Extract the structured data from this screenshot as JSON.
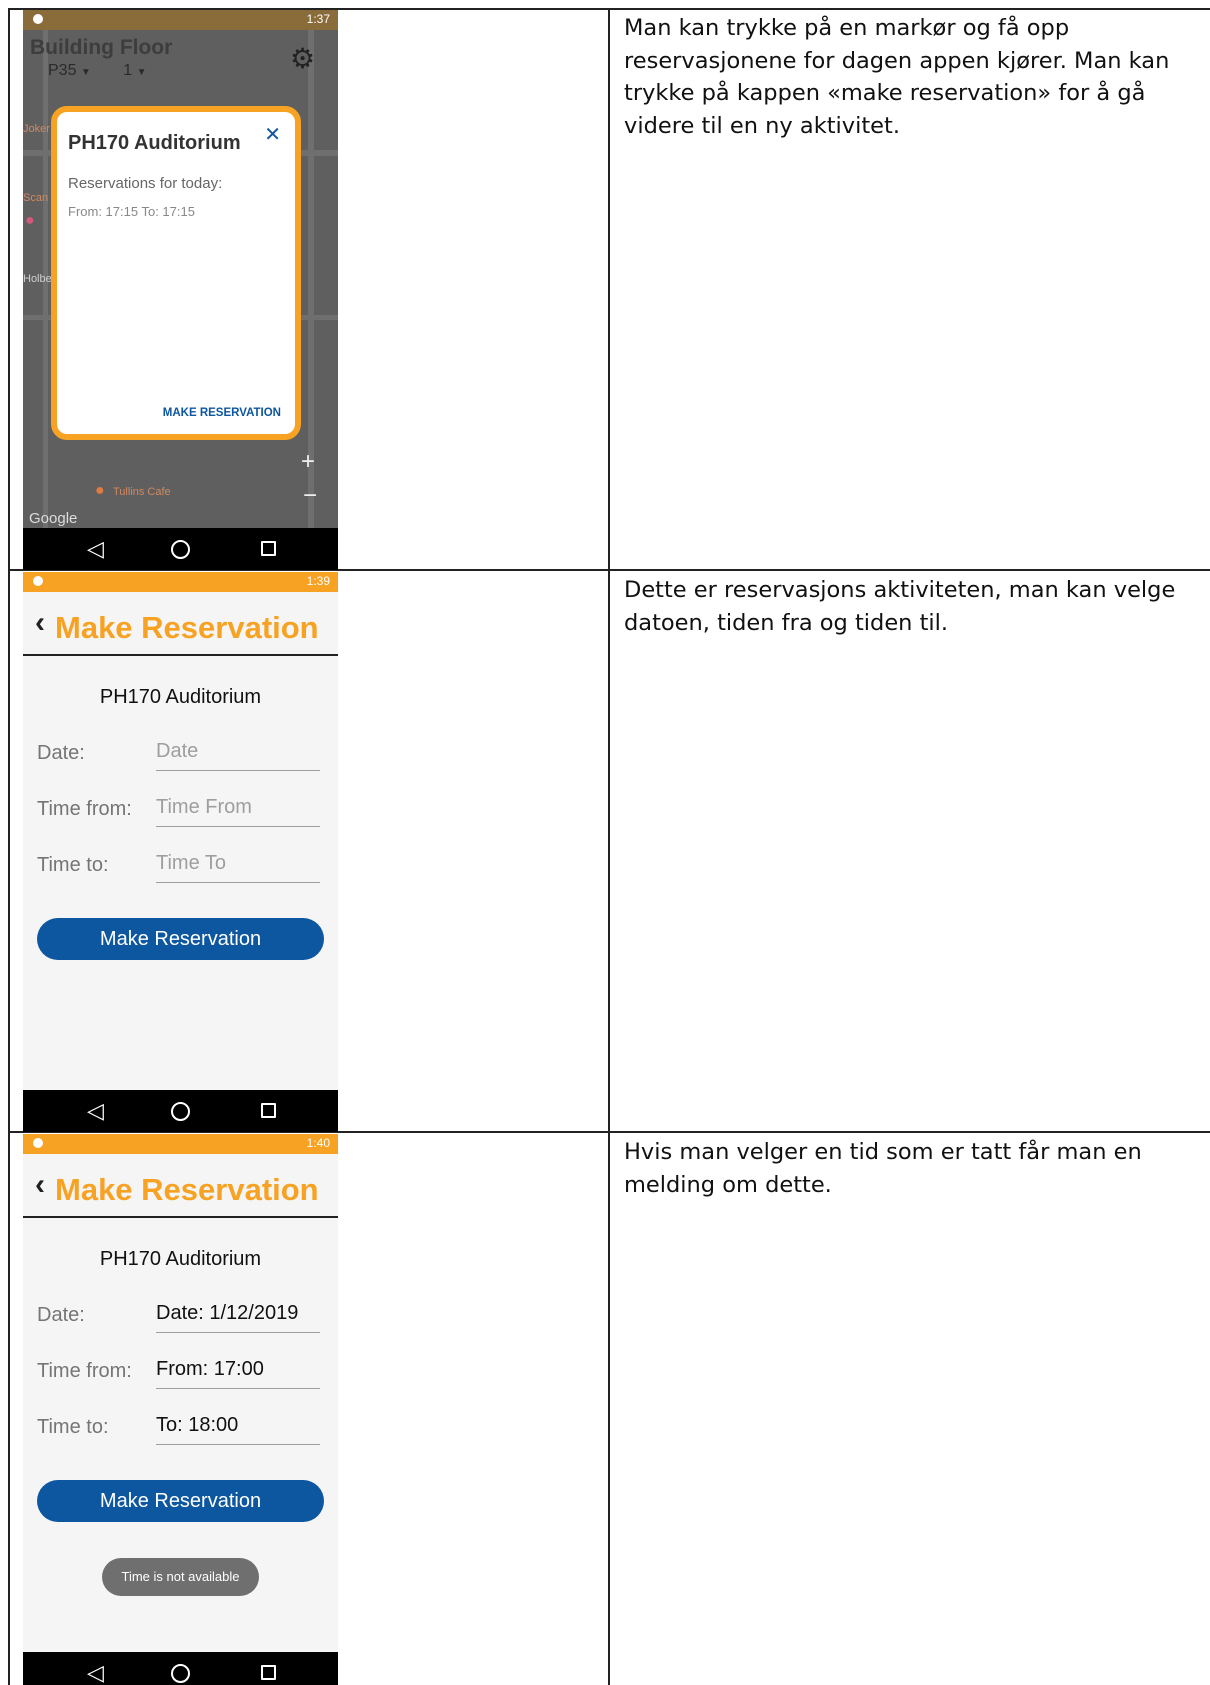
{
  "rows": [
    {
      "description": "Man kan trykke på en markør og få opp reservasjonene for dagen appen kjører. Man kan trykke på kappen «make reservation» for å gå videre til en ny aktivitet."
    },
    {
      "description": "Dette er reservasjons aktiviteten, man kan velge datoen, tiden fra og tiden til."
    },
    {
      "description": "Hvis man velger en tid som er tatt får man en melding om dette."
    }
  ],
  "screen1": {
    "status_time": "1:37",
    "header_title": "Building  Floor",
    "building_value": "P35",
    "floor_value": "1",
    "map_labels": [
      "Tullins Cafe",
      "Joker",
      "Scan",
      "Holbe",
      "Google"
    ],
    "popup": {
      "title": "PH170 Auditorium",
      "subtitle": "Reservations for today:",
      "entry": "From: 17:15 To: 17:15",
      "action": "MAKE RESERVATION"
    }
  },
  "screen2": {
    "status_time": "1:39",
    "appbar_title": "Make Reservation",
    "room": "PH170 Auditorium",
    "labels": {
      "date": "Date:",
      "from": "Time from:",
      "to": "Time to:"
    },
    "placeholders": {
      "date": "Date",
      "from": "Time From",
      "to": "Time To"
    },
    "button": "Make Reservation"
  },
  "screen3": {
    "status_time": "1:40",
    "appbar_title": "Make Reservation",
    "room": "PH170 Auditorium",
    "labels": {
      "date": "Date:",
      "from": "Time from:",
      "to": "Time to:"
    },
    "values": {
      "date": "Date: 1/12/2019",
      "from": "From: 17:00",
      "to": "To: 18:00"
    },
    "button": "Make Reservation",
    "toast": "Time is not available"
  },
  "colors": {
    "accent": "#f7a223",
    "primary": "#0d56a0",
    "navbar": "#000000"
  }
}
